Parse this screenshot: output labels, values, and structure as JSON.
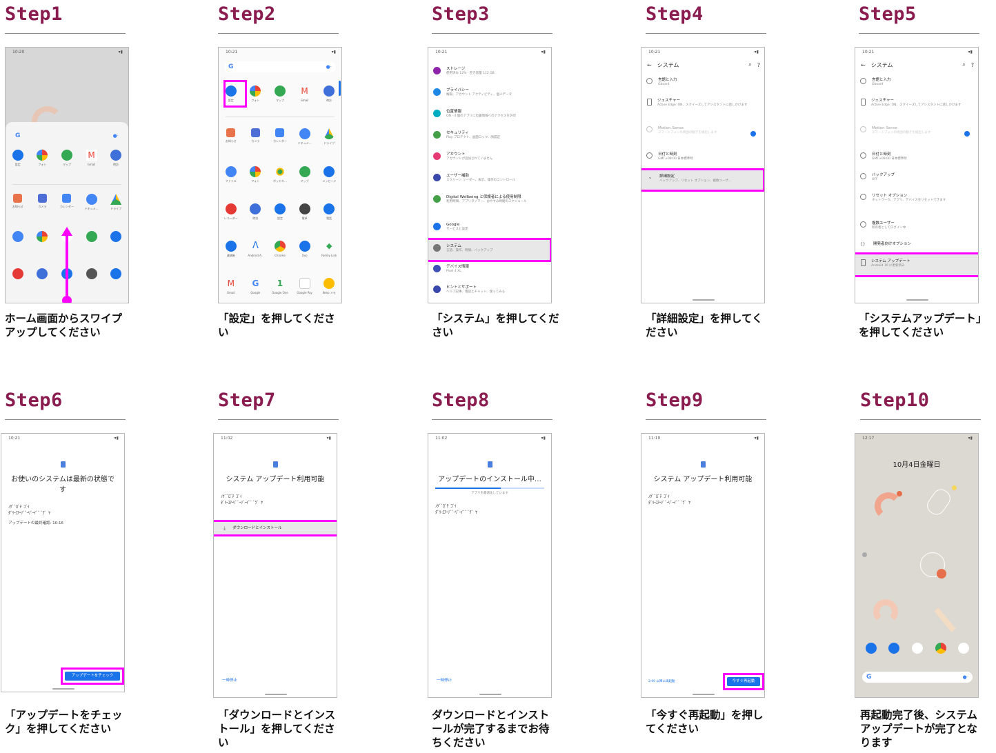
{
  "steps": [
    {
      "title": "Step1",
      "caption": "ホーム画面からスワイプアップしてください"
    },
    {
      "title": "Step2",
      "caption": "「設定」を押してください"
    },
    {
      "title": "Step3",
      "caption": "「システム」を押してください"
    },
    {
      "title": "Step4",
      "caption": "「詳細設定」を押してください"
    },
    {
      "title": "Step5",
      "caption": "「システムアップデート」を押してください"
    },
    {
      "title": "Step6",
      "caption": "「アップデートをチェック」を押してください"
    },
    {
      "title": "Step7",
      "caption": "「ダウンロードとインストール」を押してください"
    },
    {
      "title": "Step8",
      "caption": "ダウンロードとインストールが完了するまでお待ちください"
    },
    {
      "title": "Step9",
      "caption": "「今すぐ再起動」を押してください"
    },
    {
      "title": "Step10",
      "caption": "再起動完了後、システムアップデートが完了となります"
    }
  ],
  "screens": {
    "s1": {
      "time": "10:20",
      "apps_row1": [
        "設定",
        "フォト",
        "マップ",
        "Gmail",
        "時計"
      ],
      "apps_row2": [
        "お知らせ",
        "カメラ",
        "カレンダー",
        "ドキュメ…",
        "ドライブ"
      ]
    },
    "s2": {
      "time": "10:21",
      "apps_row1": [
        "設定",
        "フォト",
        "マップ",
        "Gmail",
        "時計"
      ],
      "apps_row2": [
        "お知らせ",
        "カメラ",
        "カレンダー",
        "ドキュメ…",
        "ドライブ"
      ],
      "apps_row3": [
        "ファイル",
        "フォト",
        "ポッドキ…",
        "マップ",
        "メッセージ"
      ],
      "apps_row4": [
        "レコーダー",
        "時計",
        "設定",
        "電卓",
        "電話"
      ],
      "apps_row5": [
        "連絡帳",
        "Android A..",
        "Chrome",
        "Duo",
        "Family Link"
      ],
      "apps_row6": [
        "Gmail",
        "Google",
        "Google One",
        "Google Pay",
        "Keep メモ"
      ]
    },
    "s3": {
      "time": "10:21",
      "items": [
        {
          "title": "ストレージ",
          "sub": "使用済み 12% · 空き容量 112 GB",
          "color": "#8e24aa"
        },
        {
          "title": "プライバシー",
          "sub": "権限、アカウント アクティビティ、個人データ",
          "color": "#1e88e5"
        },
        {
          "title": "位置情報",
          "sub": "ON - 4 個のアプリに位置情報へのアクセスを許可",
          "color": "#00acc1"
        },
        {
          "title": "セキュリティ",
          "sub": "Play プロテクト、画面ロック、顔認証",
          "color": "#43a047"
        },
        {
          "title": "アカウント",
          "sub": "アカウントが追加されていません",
          "color": "#e53974"
        },
        {
          "title": "ユーザー補助",
          "sub": "スクリーン リーダー、表示、操作のコントロール",
          "color": "#3949ab"
        },
        {
          "title": "Digital Wellbeing と保護者による使用制限",
          "sub": "利用時間、アプリタイマー、おやすみ時間のスケジュール",
          "color": "#43a047"
        },
        {
          "title": "Google",
          "sub": "サービスと設定",
          "color": "#1a73e8"
        },
        {
          "title": "システム",
          "sub": "言語、操作、時間、バックアップ",
          "color": "#757575"
        },
        {
          "title": "デバイス情報",
          "sub": "Pixel 4 XL",
          "color": "#3f51b5"
        },
        {
          "title": "ヒントとサポート",
          "sub": "ヘルプ記事、電話とチャット、使ってみる",
          "color": "#3949ab"
        }
      ]
    },
    "s4": {
      "time": "10:21",
      "header": "システム",
      "items": [
        {
          "title": "言語と入力",
          "sub": "Gboard"
        },
        {
          "title": "ジェスチャー",
          "sub": "Active Edge: ON、スクイーズしてアシスタントに話しかけます"
        },
        {
          "title": "Motion Sense",
          "sub": "スマートフォンの周囲の動きを検出します"
        },
        {
          "title": "日付と時刻",
          "sub": "GMT+09:00 日本標準時"
        },
        {
          "title": "詳細設定",
          "sub": "バックアップ、リセット オプション、複数ユーザ…"
        }
      ]
    },
    "s5": {
      "time": "10:21",
      "header": "システム",
      "items": [
        {
          "title": "言語と入力",
          "sub": "Gboard"
        },
        {
          "title": "ジェスチャー",
          "sub": "Active Edge: ON、スクイーズしてアシスタントに話しかけます"
        },
        {
          "title": "Motion Sense",
          "sub": "スマートフォンの周囲の動きを検出します"
        },
        {
          "title": "日付と時刻",
          "sub": "GMT+09:00 日本標準時"
        },
        {
          "title": "バックアップ",
          "sub": "OFF"
        },
        {
          "title": "リセット オプション",
          "sub": "ネットワーク、アプリ、デバイスをリセットできます"
        },
        {
          "title": "複数ユーザー",
          "sub": "所有者としてログイン中"
        },
        {
          "title": "開発者向けオプション",
          "sub": ""
        },
        {
          "title": "システム アップデート",
          "sub": "Android 10 に更新済み"
        }
      ]
    },
    "s6": {
      "time": "10:21",
      "heading": "お使いのシステムは最新の状態です",
      "last_check": "アップデートの最終確認: 10:16",
      "button": "アップデートをチェック"
    },
    "s7": {
      "time": "11:02",
      "heading": "システム アップデート利用可能",
      "download": "ダウンロードとインストール",
      "pause": "一時停止"
    },
    "s8": {
      "time": "11:02",
      "heading": "アップデートのインストール中…",
      "progress_label": "アプリを最適化しています",
      "progress": 0.6,
      "pause": "一時停止"
    },
    "s9": {
      "time": "11:10",
      "heading": "システム アップデート利用可能",
      "later": "2:00 以降に再起動",
      "button": "今すぐ再起動"
    },
    "s10": {
      "time": "12:17",
      "date": "10月4日金曜日"
    }
  }
}
